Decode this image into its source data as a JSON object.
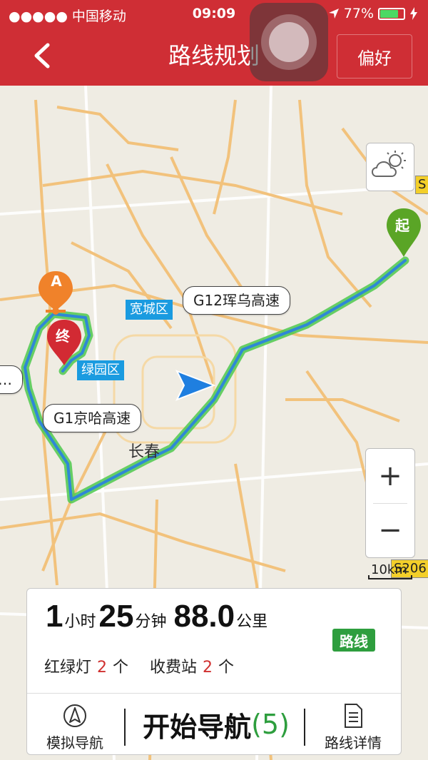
{
  "status_bar": {
    "signal": "●●●●● 中国移动",
    "time": "09:09",
    "battery_text": "77%",
    "battery_level": 0.77
  },
  "nav": {
    "title": "路线规划",
    "preference": "偏好"
  },
  "map": {
    "start_marker": "起",
    "end_marker": "终",
    "poi_marker": "A",
    "district_labels": [
      "宽城区",
      "绿园区"
    ],
    "city_label": "长春",
    "road_callouts": {
      "g12": "G12珲乌高速",
      "g1": "G1京哈高速",
      "left_trunc": "…"
    },
    "road_shields": [
      "S",
      "S206"
    ],
    "scale_label": "10km",
    "zoom_in": "+",
    "zoom_out": "−",
    "weather_icon": "partly-cloudy-icon"
  },
  "route": {
    "hours": "1",
    "hours_unit": "小时",
    "minutes": "25",
    "minutes_unit": "分钟",
    "distance": "88.0",
    "distance_unit": "公里",
    "badge": "路线",
    "lights_label": "红绿灯",
    "lights_count": "2",
    "toll_label": "收费站",
    "toll_count": "2",
    "unit_ge": "个"
  },
  "actions": {
    "simulate": "模拟导航",
    "start": "开始导航",
    "start_count": "(5)",
    "details": "路线详情"
  },
  "colors": {
    "header": "#cf2e35",
    "route": "#2f87d6",
    "route_glow": "#4ec94e",
    "badge_green": "#2e9e3e",
    "count_red": "#d0302f"
  }
}
